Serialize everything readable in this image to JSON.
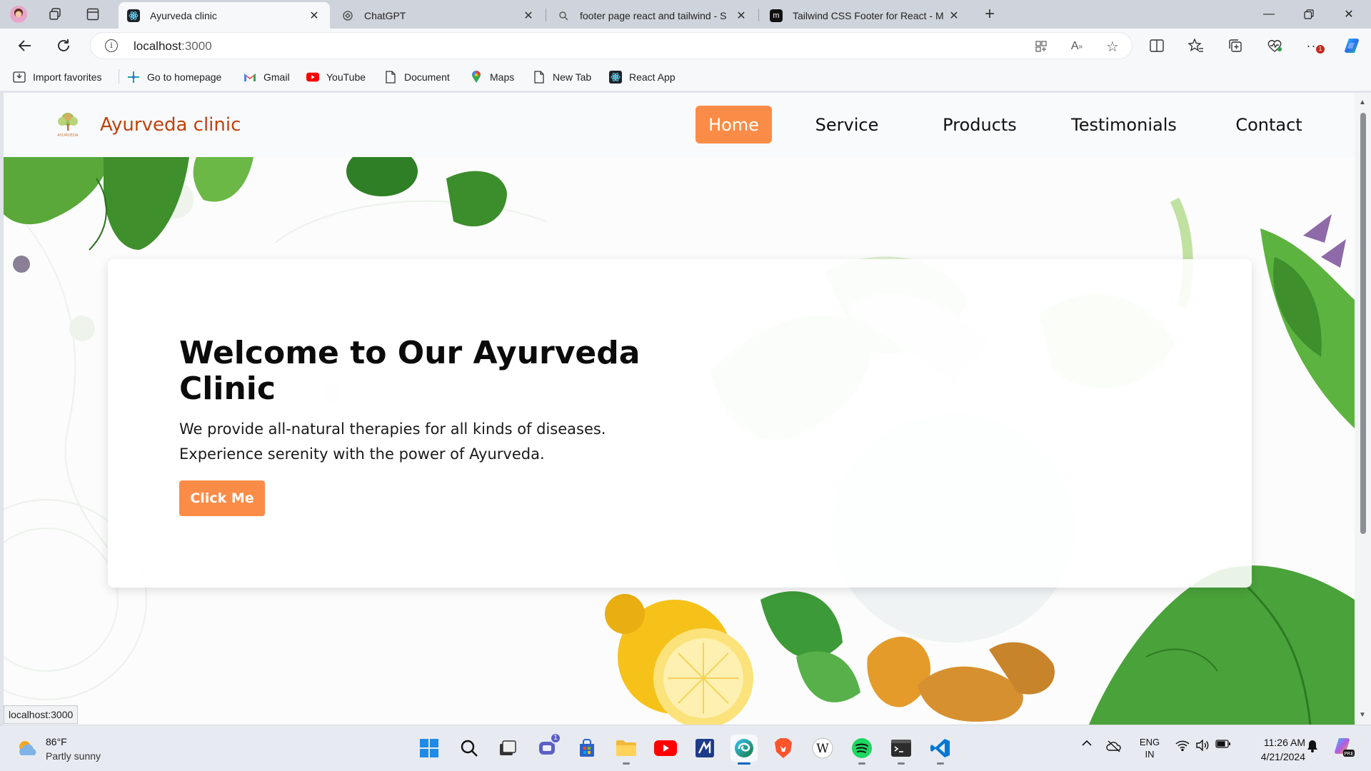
{
  "browser": {
    "tabs": [
      {
        "title": "Ayurveda clinic",
        "active": true
      },
      {
        "title": "ChatGPT",
        "active": false
      },
      {
        "title": "footer page react and tailwind - S",
        "active": false
      },
      {
        "title": "Tailwind CSS Footer for React - M",
        "active": false
      }
    ],
    "address": {
      "host": "localhost",
      "port": ":3000"
    },
    "favorites": [
      {
        "label": "Import favorites",
        "icon": "import-icon"
      },
      {
        "label": "Go to homepage",
        "icon": "homepage-icon"
      },
      {
        "label": "Gmail",
        "icon": "gmail-icon"
      },
      {
        "label": "YouTube",
        "icon": "youtube-icon"
      },
      {
        "label": "Document",
        "icon": "document-icon"
      },
      {
        "label": "Maps",
        "icon": "maps-icon"
      },
      {
        "label": "New Tab",
        "icon": "document-icon"
      },
      {
        "label": "React App",
        "icon": "react-icon"
      }
    ],
    "status_url": "localhost:3000",
    "notification_badge": "1"
  },
  "site": {
    "brand": "Ayurveda clinic",
    "logo_text": "AYURVEDA",
    "nav": [
      {
        "label": "Home",
        "active": true
      },
      {
        "label": "Service",
        "active": false
      },
      {
        "label": "Products",
        "active": false
      },
      {
        "label": "Testimonials",
        "active": false
      },
      {
        "label": "Contact",
        "active": false
      }
    ],
    "hero": {
      "title": "Welcome to Our Ayurveda Clinic",
      "text": "We provide all-natural therapies for all kinds of diseases. Experience serenity with the power of Ayurveda.",
      "button": "Click Me"
    },
    "colors": {
      "accent": "#fb8c47",
      "brand": "#c2410c"
    }
  },
  "taskbar": {
    "weather": {
      "temp": "86°F",
      "desc": "Partly sunny"
    },
    "teams_badge": "1",
    "lang": {
      "line1": "ENG",
      "line2": "IN"
    },
    "time": "11:26 AM",
    "date": "4/21/2024"
  }
}
